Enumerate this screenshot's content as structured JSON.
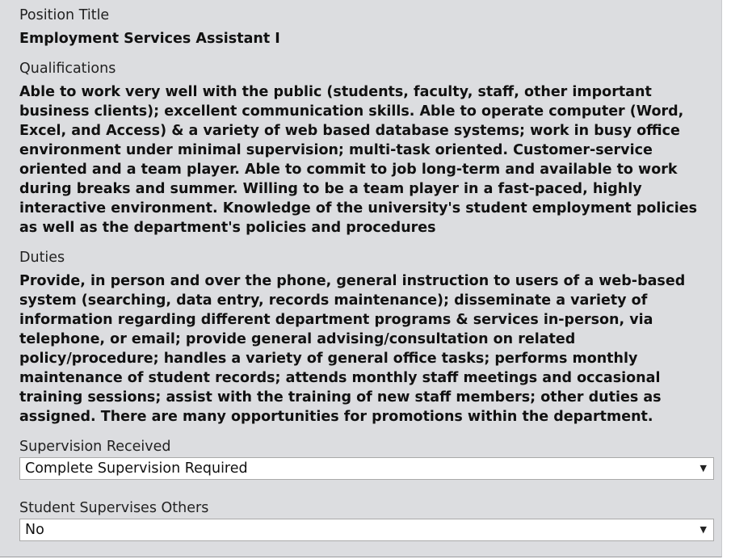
{
  "position": {
    "label": "Position Title",
    "value": "Employment Services Assistant I"
  },
  "qualifications": {
    "label": "Qualifications",
    "value": "Able to work very well with the public (students, faculty, staff, other important business clients); excellent communication skills. Able to operate computer (Word, Excel, and Access) & a variety of web based database systems; work in busy office environment under minimal supervision; multi-task oriented. Customer-service oriented and a team player. Able to commit to job long-term and available to work during breaks and summer. Willing to be a team player in a fast-paced, highly interactive environment. Knowledge of the university's student employment policies as well as the department's policies and procedures"
  },
  "duties": {
    "label": "Duties",
    "value": "Provide, in person and over the phone, general instruction to users of a web-based system (searching, data entry, records maintenance); disseminate a variety of information regarding different department programs & services in-person, via telephone, or email; provide general advising/consultation on related policy/procedure; handles a variety of general office tasks; performs monthly maintenance of student records; attends monthly staff meetings and occasional training sessions; assist with the training of new staff members; other duties as assigned. There are many opportunities for promotions within the department."
  },
  "supervision_received": {
    "label": "Supervision Received",
    "selected": "Complete Supervision Required"
  },
  "supervises_others": {
    "label": "Student Supervises Others",
    "selected": "No"
  },
  "icons": {
    "dropdown": "chevron-down-icon",
    "caret_glyph": "▼"
  }
}
